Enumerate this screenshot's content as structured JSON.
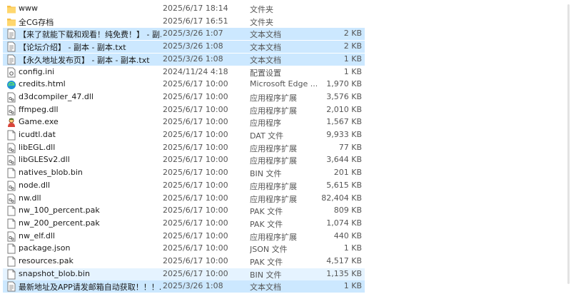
{
  "colors": {
    "selected": "#cce8ff",
    "hover": "#e5f3ff",
    "folder": "#f7c04a"
  },
  "files": [
    {
      "name": "www",
      "date": "2025/6/17 18:14",
      "type": "文件夹",
      "size": "",
      "icon": "folder-icon",
      "state": ""
    },
    {
      "name": "全CG存档",
      "date": "2025/6/17 16:51",
      "type": "文件夹",
      "size": "",
      "icon": "folder-icon",
      "state": ""
    },
    {
      "name": "【来了就能下载和观看！纯免费！】 - 副...",
      "date": "2025/3/26 1:07",
      "type": "文本文档",
      "size": "2 KB",
      "icon": "text-file-icon",
      "state": "selected"
    },
    {
      "name": "【论坛介绍】 - 副本 - 副本.txt",
      "date": "2025/3/26 1:08",
      "type": "文本文档",
      "size": "2 KB",
      "icon": "text-file-icon",
      "state": "selected"
    },
    {
      "name": "【永久地址发布页】 - 副本 - 副本.txt",
      "date": "2025/3/26 1:08",
      "type": "文本文档",
      "size": "1 KB",
      "icon": "text-file-icon",
      "state": "selected"
    },
    {
      "name": "config.ini",
      "date": "2024/11/24 4:18",
      "type": "配置设置",
      "size": "1 KB",
      "icon": "config-file-icon",
      "state": ""
    },
    {
      "name": "credits.html",
      "date": "2025/6/17 10:00",
      "type": "Microsoft Edge ...",
      "size": "1,970 KB",
      "icon": "edge-icon",
      "state": ""
    },
    {
      "name": "d3dcompiler_47.dll",
      "date": "2025/6/17 10:00",
      "type": "应用程序扩展",
      "size": "3,576 KB",
      "icon": "dll-file-icon",
      "state": ""
    },
    {
      "name": "ffmpeg.dll",
      "date": "2025/6/17 10:00",
      "type": "应用程序扩展",
      "size": "2,010 KB",
      "icon": "dll-file-icon",
      "state": ""
    },
    {
      "name": "Game.exe",
      "date": "2025/6/17 10:00",
      "type": "应用程序",
      "size": "1,567 KB",
      "icon": "game-exe-icon",
      "state": ""
    },
    {
      "name": "icudtl.dat",
      "date": "2025/6/17 10:00",
      "type": "DAT 文件",
      "size": "9,933 KB",
      "icon": "file-icon",
      "state": ""
    },
    {
      "name": "libEGL.dll",
      "date": "2025/6/17 10:00",
      "type": "应用程序扩展",
      "size": "77 KB",
      "icon": "dll-file-icon",
      "state": ""
    },
    {
      "name": "libGLESv2.dll",
      "date": "2025/6/17 10:00",
      "type": "应用程序扩展",
      "size": "3,644 KB",
      "icon": "dll-file-icon",
      "state": ""
    },
    {
      "name": "natives_blob.bin",
      "date": "2025/6/17 10:00",
      "type": "BIN 文件",
      "size": "201 KB",
      "icon": "file-icon",
      "state": ""
    },
    {
      "name": "node.dll",
      "date": "2025/6/17 10:00",
      "type": "应用程序扩展",
      "size": "5,615 KB",
      "icon": "dll-file-icon",
      "state": ""
    },
    {
      "name": "nw.dll",
      "date": "2025/6/17 10:00",
      "type": "应用程序扩展",
      "size": "82,404 KB",
      "icon": "dll-file-icon",
      "state": ""
    },
    {
      "name": "nw_100_percent.pak",
      "date": "2025/6/17 10:00",
      "type": "PAK 文件",
      "size": "809 KB",
      "icon": "file-icon",
      "state": ""
    },
    {
      "name": "nw_200_percent.pak",
      "date": "2025/6/17 10:00",
      "type": "PAK 文件",
      "size": "1,074 KB",
      "icon": "file-icon",
      "state": ""
    },
    {
      "name": "nw_elf.dll",
      "date": "2025/6/17 10:00",
      "type": "应用程序扩展",
      "size": "440 KB",
      "icon": "dll-file-icon",
      "state": ""
    },
    {
      "name": "package.json",
      "date": "2025/6/17 10:00",
      "type": "JSON 文件",
      "size": "1 KB",
      "icon": "file-icon",
      "state": ""
    },
    {
      "name": "resources.pak",
      "date": "2025/6/17 10:00",
      "type": "PAK 文件",
      "size": "4,517 KB",
      "icon": "file-icon",
      "state": ""
    },
    {
      "name": "snapshot_blob.bin",
      "date": "2025/6/17 10:00",
      "type": "BIN 文件",
      "size": "1,135 KB",
      "icon": "file-icon",
      "state": "hover"
    },
    {
      "name": "最新地址及APP请发邮箱自动获取！！！...",
      "date": "2025/3/26 1:08",
      "type": "文本文档",
      "size": "1 KB",
      "icon": "text-file-icon",
      "state": "selected"
    }
  ]
}
